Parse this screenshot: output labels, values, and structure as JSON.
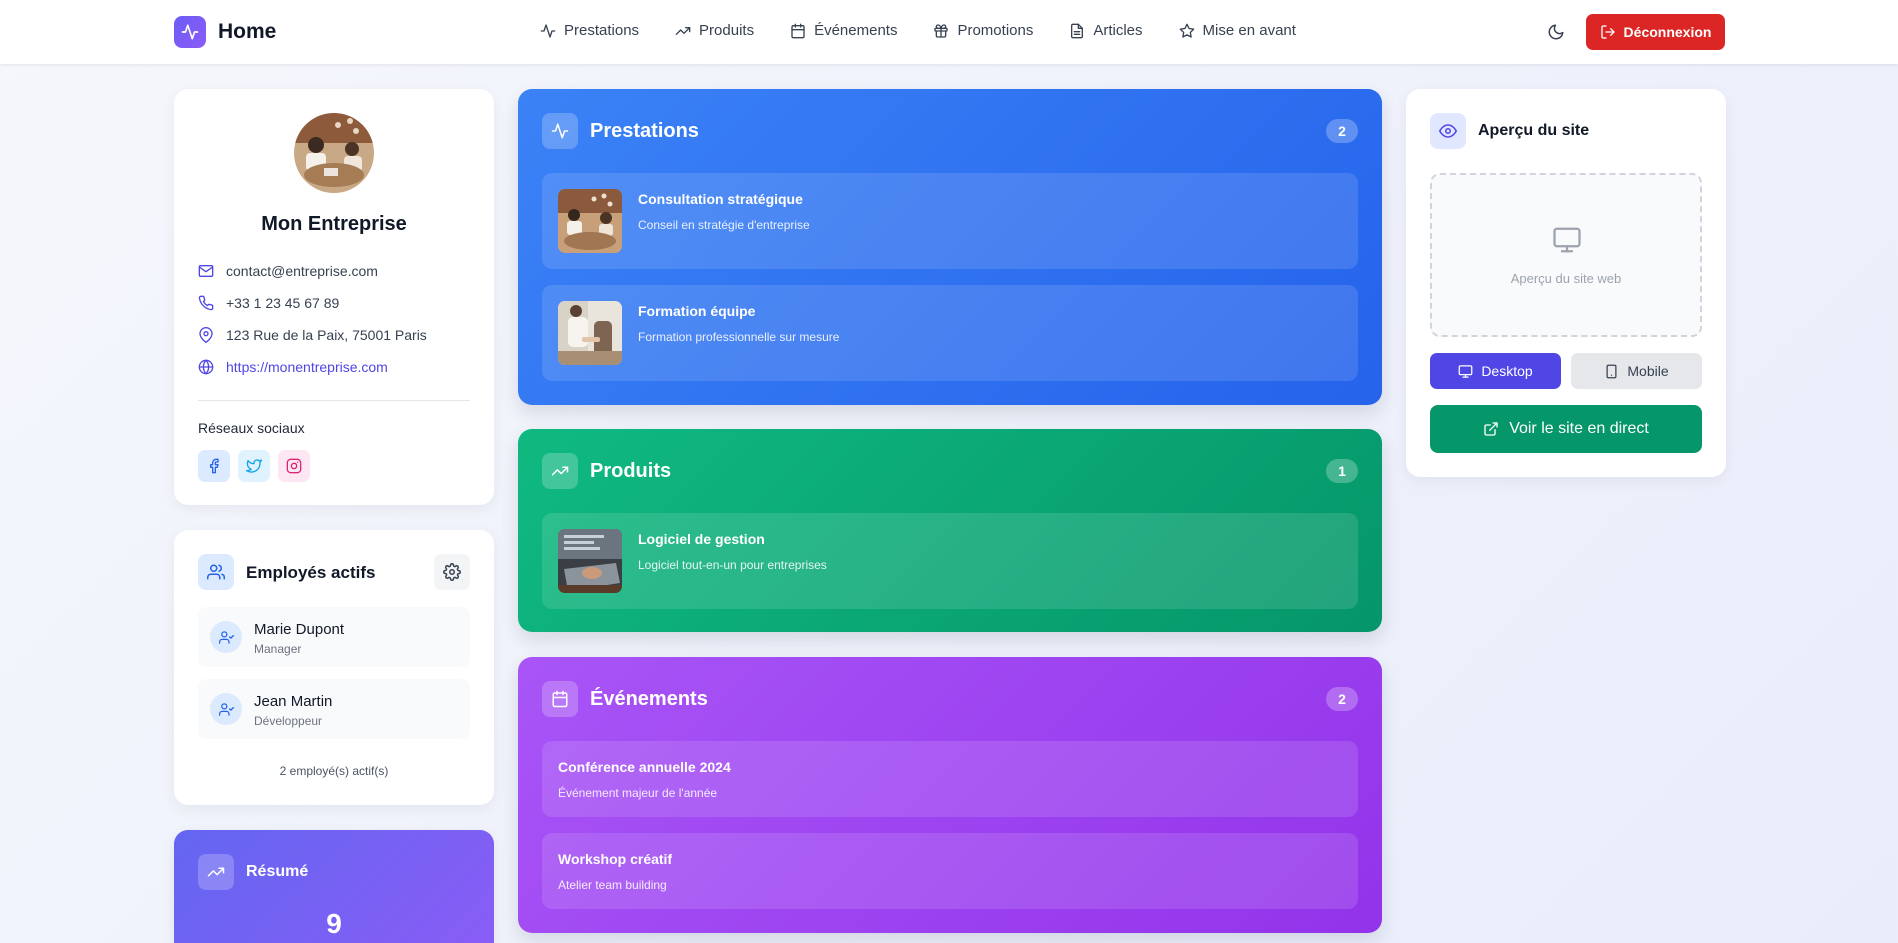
{
  "header": {
    "title": "Home",
    "nav": [
      {
        "label": "Prestations",
        "icon": "activity-icon"
      },
      {
        "label": "Produits",
        "icon": "trending-up-icon"
      },
      {
        "label": "Événements",
        "icon": "calendar-icon"
      },
      {
        "label": "Promotions",
        "icon": "gift-icon"
      },
      {
        "label": "Articles",
        "icon": "file-text-icon"
      },
      {
        "label": "Mise en avant",
        "icon": "star-icon"
      }
    ],
    "logout_label": "Déconnexion"
  },
  "profile": {
    "name": "Mon Entreprise",
    "email": "contact@entreprise.com",
    "phone": "+33 1 23 45 67 89",
    "address": "123 Rue de la Paix, 75001 Paris",
    "website": "https://monentreprise.com",
    "social_title": "Réseaux sociaux"
  },
  "employees": {
    "title": "Employés actifs",
    "items": [
      {
        "name": "Marie Dupont",
        "role": "Manager"
      },
      {
        "name": "Jean Martin",
        "role": "Développeur"
      }
    ],
    "count_text": "2 employé(s) actif(s)"
  },
  "summary": {
    "title": "Résumé",
    "total": "9"
  },
  "sections": {
    "prestations": {
      "title": "Prestations",
      "badge": "2",
      "items": [
        {
          "title": "Consultation stratégique",
          "desc": "Conseil en stratégie d'entreprise"
        },
        {
          "title": "Formation équipe",
          "desc": "Formation professionnelle sur mesure"
        }
      ]
    },
    "produits": {
      "title": "Produits",
      "badge": "1",
      "items": [
        {
          "title": "Logiciel de gestion",
          "desc": "Logiciel tout-en-un pour entreprises"
        }
      ]
    },
    "evenements": {
      "title": "Événements",
      "badge": "2",
      "items": [
        {
          "title": "Conférence annuelle 2024",
          "desc": "Événement majeur de l'année"
        },
        {
          "title": "Workshop créatif",
          "desc": "Atelier team building"
        }
      ]
    }
  },
  "preview": {
    "title": "Aperçu du site",
    "placeholder": "Aperçu du site web",
    "desktop_label": "Desktop",
    "mobile_label": "Mobile",
    "live_label": "Voir le site en direct"
  },
  "colors": {
    "accent": "#4f46e5",
    "danger": "#dc2626",
    "prestations": "#3b82f6",
    "produits": "#10b981",
    "evenements": "#a855f7",
    "live_button": "#059669"
  }
}
